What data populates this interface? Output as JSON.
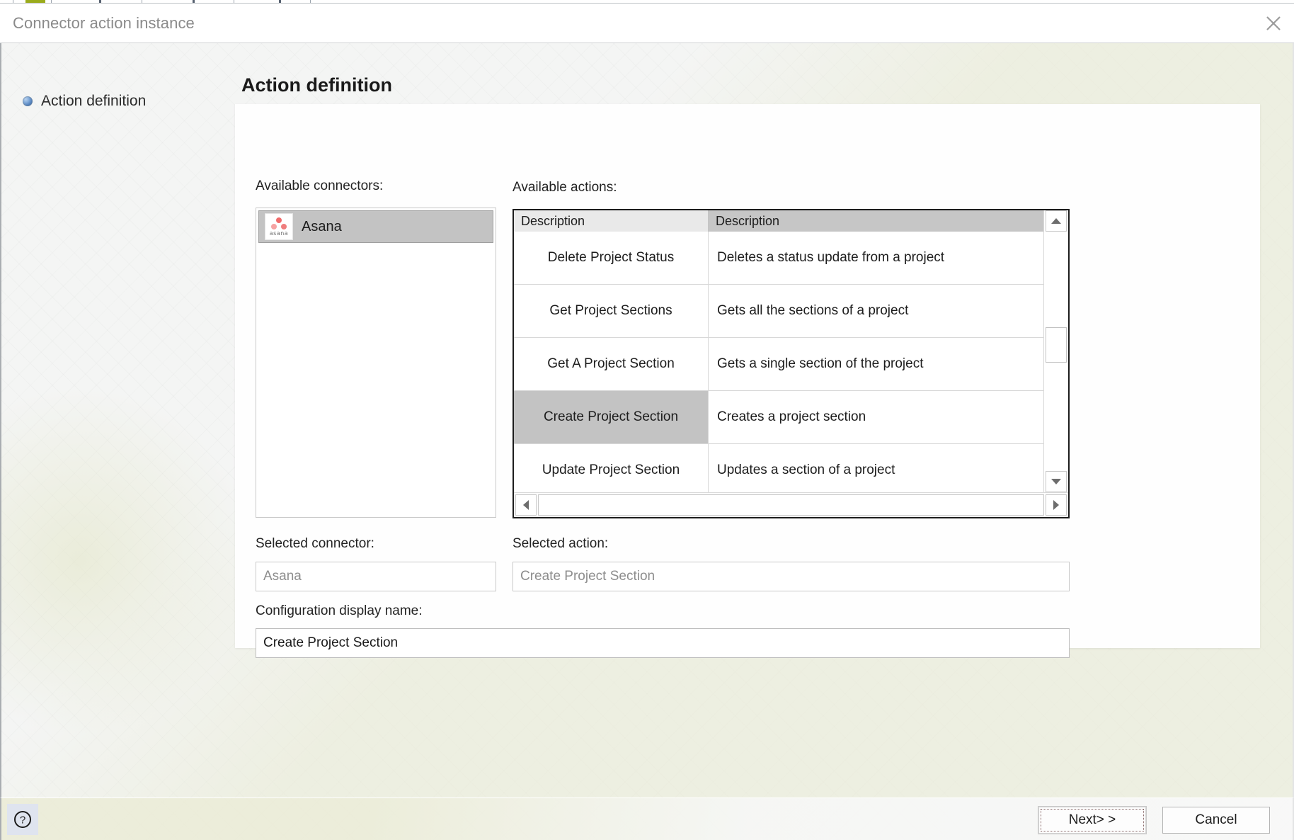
{
  "window": {
    "title": "Connector action instance",
    "close_icon": "close-icon"
  },
  "nav": {
    "items": [
      {
        "label": "Action definition",
        "icon": "sphere-bullet-icon",
        "selected": true
      }
    ]
  },
  "page": {
    "title": "Action definition"
  },
  "connectors": {
    "label": "Available connectors:",
    "items": [
      {
        "name": "Asana",
        "icon": "asana-logo-icon",
        "wordmark": "asana",
        "selected": true
      }
    ]
  },
  "actions": {
    "label": "Available actions:",
    "columns": [
      "Description",
      "Description"
    ],
    "rows": [
      {
        "name": "Delete Project Status",
        "description": "Deletes a status update from a project",
        "selected": false
      },
      {
        "name": "Get Project Sections",
        "description": "Gets all the sections of a project",
        "selected": false
      },
      {
        "name": "Get A Project Section",
        "description": "Gets a single section of the project",
        "selected": false
      },
      {
        "name": "Create Project Section",
        "description": "Creates a project section",
        "selected": true
      },
      {
        "name": "Update Project Section",
        "description": "Updates a section of a project",
        "selected": false
      }
    ],
    "scroll": {
      "vertical_up_icon": "triangle-up-icon",
      "vertical_down_icon": "triangle-down-icon",
      "horizontal_left_icon": "triangle-left-icon",
      "horizontal_right_icon": "triangle-right-icon"
    }
  },
  "fields": {
    "selected_connector_label": "Selected connector:",
    "selected_connector_value": "Asana",
    "selected_action_label": "Selected action:",
    "selected_action_value": "Create Project Section",
    "display_name_label": "Configuration display name:",
    "display_name_value": "Create Project Section"
  },
  "footer": {
    "help_label": "?",
    "next_label": "Next> >",
    "cancel_label": "Cancel"
  },
  "colors": {
    "accent_olive": "#9aab1c",
    "selection_gray": "#c3c3c3",
    "asana_coral": "#f06a6a"
  }
}
